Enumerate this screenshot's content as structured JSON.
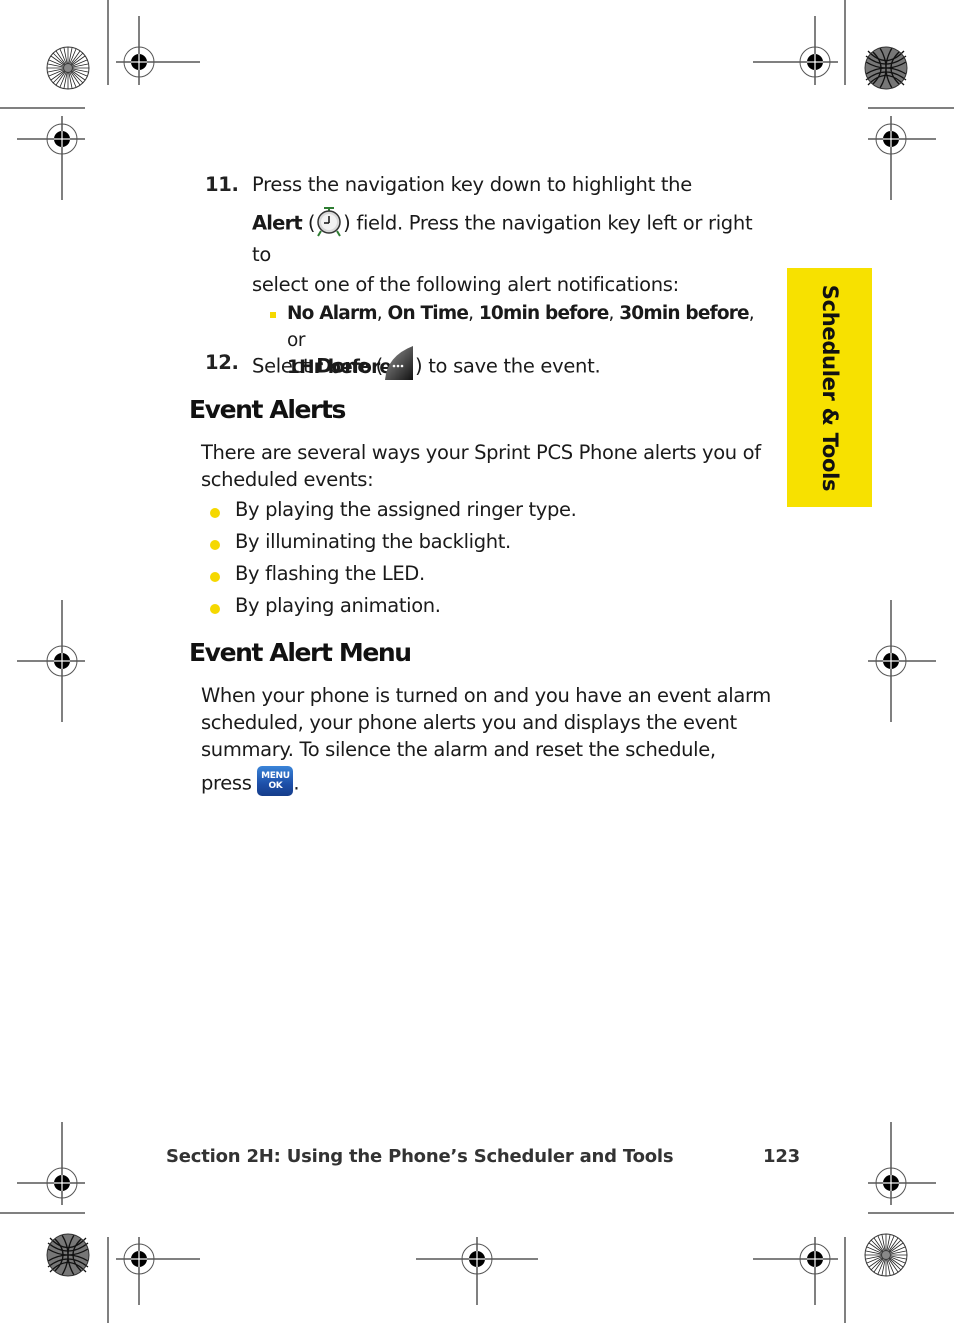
{
  "steps": [
    {
      "number": "11.",
      "line1": "Press the navigation key down to highlight the",
      "alert_label": "Alert",
      "alert_icon": "alarm-clock-icon",
      "line2_after_icon": ") field. Press the navigation key left or right to",
      "line3": "select one of the following alert notifications:",
      "options": {
        "bullet_icon": "square-bullet",
        "items": [
          "No Alarm",
          "On Time",
          "10min before",
          "30min before",
          "1Hr before"
        ],
        "separator": ", ",
        "conjunction": ", or"
      }
    },
    {
      "number": "12.",
      "prefix": "Select",
      "done_label": "Done",
      "done_icon": "softkey-done-icon",
      "suffix": ") to save the event."
    }
  ],
  "event_alerts": {
    "heading": "Event Alerts",
    "intro_line1": "There are several ways your Sprint PCS Phone alerts you of",
    "intro_line2": "scheduled events:",
    "bullets": [
      "By playing the assigned ringer type.",
      "By illuminating the backlight.",
      "By flashing the LED.",
      "By playing animation."
    ]
  },
  "event_alert_menu": {
    "heading": "Event Alert Menu",
    "lines": [
      "When your phone is turned on and you have an event alarm",
      "scheduled, your phone alerts you and displays the event",
      "summary. To silence the alarm and reset the schedule,"
    ],
    "press_label": "press",
    "key_line1": "MENU",
    "key_line2": "OK",
    "trailing": "."
  },
  "side_tab": {
    "label": "Scheduler & Tools",
    "color": "#f7e100"
  },
  "footer": {
    "section": "Section 2H: Using the Phone’s Scheduler and Tools",
    "page_number": "123"
  },
  "colors": {
    "bullet": "#f5d800",
    "menu_key": "#1d4fa8",
    "alarm_green": "#2e7d32"
  }
}
